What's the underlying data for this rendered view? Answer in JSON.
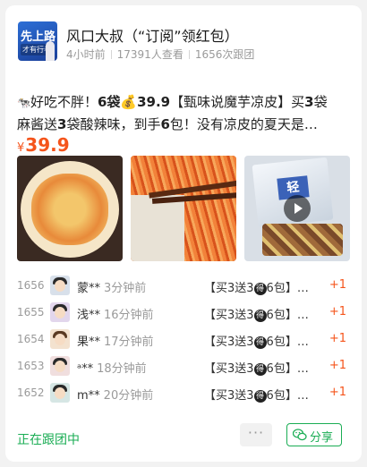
{
  "header": {
    "logo_line1": "先上路",
    "logo_line2": "才有行者",
    "title": "风口大叔（“订阅”领红包）",
    "posted": "4小时前",
    "views": "17391人查看",
    "follows": "1656次跟团"
  },
  "post": {
    "description_line1_a": "好吃不胖！",
    "description_line1_b": "6袋",
    "description_line1_c": "39.9",
    "description_line1_d": "【甄味说魔芋凉皮】买",
    "description_line1_e": "3",
    "description_line1_f": "袋",
    "description_line2_a": "麻酱送",
    "description_line2_b": "3",
    "description_line2_c": "袋酸辣味，到手",
    "description_line2_d": "6",
    "description_line2_e": "包！没有凉皮的夏天是…",
    "price_symbol": "¥",
    "price": "39.9",
    "package_tag": "轻"
  },
  "followers": [
    {
      "number": "1656",
      "name": "蒙**",
      "ago": "3分钟前",
      "item_a": "【买3送3",
      "item_b": "6包】…",
      "plus": "+1"
    },
    {
      "number": "1655",
      "name": "浅**",
      "ago": "16分钟前",
      "item_a": "【买3送3",
      "item_b": "6包】…",
      "plus": "+1"
    },
    {
      "number": "1654",
      "name": "果**",
      "ago": "17分钟前",
      "item_a": "【买3送3",
      "item_b": "6包】…",
      "plus": "+1"
    },
    {
      "number": "1653",
      "name": "ᵃ**",
      "ago": "18分钟前",
      "item_a": "【买3送3",
      "item_b": "6包】…",
      "plus": "+1"
    },
    {
      "number": "1652",
      "name": "m**",
      "ago": "20分钟前",
      "item_a": "【买3送3",
      "item_b": "6包】…",
      "plus": "+1"
    }
  ],
  "item_badge": "得",
  "footer": {
    "status": "正在跟团中",
    "more": "···",
    "share": "分享"
  },
  "colors": {
    "accent_orange": "#f5541b",
    "accent_green": "#1aad54"
  },
  "icons": {
    "leading_emoji": "cow-emoji",
    "money_bag": "money-bag-emoji",
    "play": "play-icon",
    "wechat": "wechat-icon"
  }
}
